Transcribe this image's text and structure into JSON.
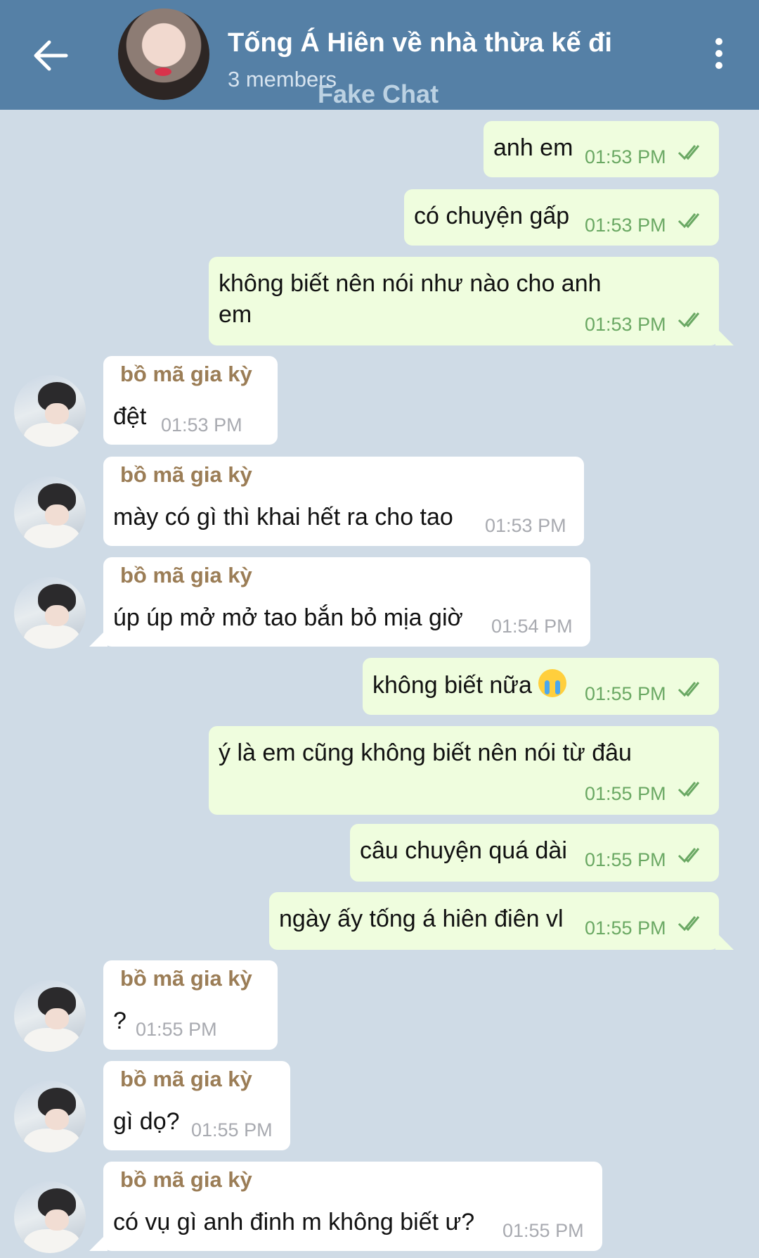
{
  "header": {
    "title": "Tống Á Hiên về nhà thừa kế đi",
    "subtitle": "3 members",
    "watermark": "Fake Chat"
  },
  "messages": [
    {
      "dir": "out",
      "text": "anh em",
      "time": "01:53 PM"
    },
    {
      "dir": "out",
      "text": "có chuyện gấp",
      "time": "01:53 PM"
    },
    {
      "dir": "out",
      "text": "không biết nên nói như nào cho anh em",
      "time": "01:53 PM"
    },
    {
      "dir": "in",
      "sender": "bồ mã gia kỳ",
      "text": "đệt",
      "time": "01:53 PM"
    },
    {
      "dir": "in",
      "sender": "bồ mã gia kỳ",
      "text": "mày có gì thì khai hết ra cho tao",
      "time": "01:53 PM"
    },
    {
      "dir": "in",
      "sender": "bồ mã gia kỳ",
      "text": "úp úp mở mở tao bắn bỏ mịa giờ",
      "time": "01:54 PM"
    },
    {
      "dir": "out",
      "text": "không biết nữa",
      "emoji": "crying-face",
      "time": "01:55 PM"
    },
    {
      "dir": "out",
      "text": "ý là em cũng không biết nên nói từ đâu",
      "time": "01:55 PM"
    },
    {
      "dir": "out",
      "text": "câu chuyện quá dài",
      "time": "01:55 PM"
    },
    {
      "dir": "out",
      "text": "ngày ấy tống á hiên điên vl",
      "time": "01:55 PM"
    },
    {
      "dir": "in",
      "sender": "bồ mã gia kỳ",
      "text": "?",
      "time": "01:55 PM"
    },
    {
      "dir": "in",
      "sender": "bồ mã gia kỳ",
      "text": "gì dọ?",
      "time": "01:55 PM"
    },
    {
      "dir": "in",
      "sender": "bồ mã gia kỳ",
      "text": "có vụ gì anh đinh m không biết ư?",
      "time": "01:55 PM"
    }
  ],
  "colors": {
    "header_bg": "#5580a6",
    "chat_bg": "#cfdbe6",
    "outgoing_bubble": "#effdde",
    "incoming_bubble": "#ffffff",
    "sender_name": "#9b7d56",
    "read_ticks": "#6aa863"
  },
  "icons": {
    "back": "arrow-left-icon",
    "menu": "more-vertical-icon",
    "status": "double-check-icon"
  }
}
